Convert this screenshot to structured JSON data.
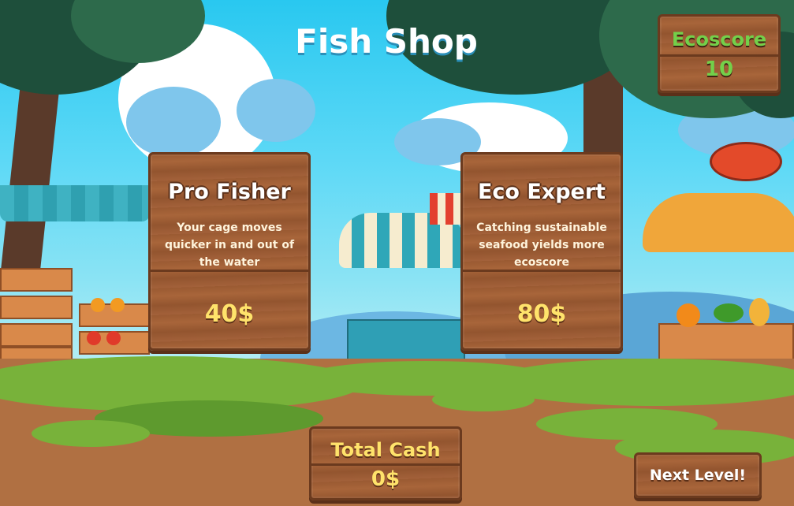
{
  "screen_title": "Fish Shop",
  "ecoscore": {
    "label": "Ecoscore",
    "value": "10"
  },
  "shop_items": [
    {
      "name": "Pro Fisher",
      "description": "Your cage moves quicker in and out of the water",
      "price": "40$"
    },
    {
      "name": "Eco Expert",
      "description": "Catching sustainable seafood yields more ecoscore",
      "price": "80$"
    }
  ],
  "total_cash": {
    "label": "Total Cash",
    "value": "0$"
  },
  "next_level_label": "Next Level!",
  "colors": {
    "sky": "#29c8f0",
    "wood": "#a3613a",
    "ecoscore_text": "#73d04a",
    "price_text": "#ffe36b",
    "ground": "#b07042",
    "grass": "#78b23a"
  }
}
